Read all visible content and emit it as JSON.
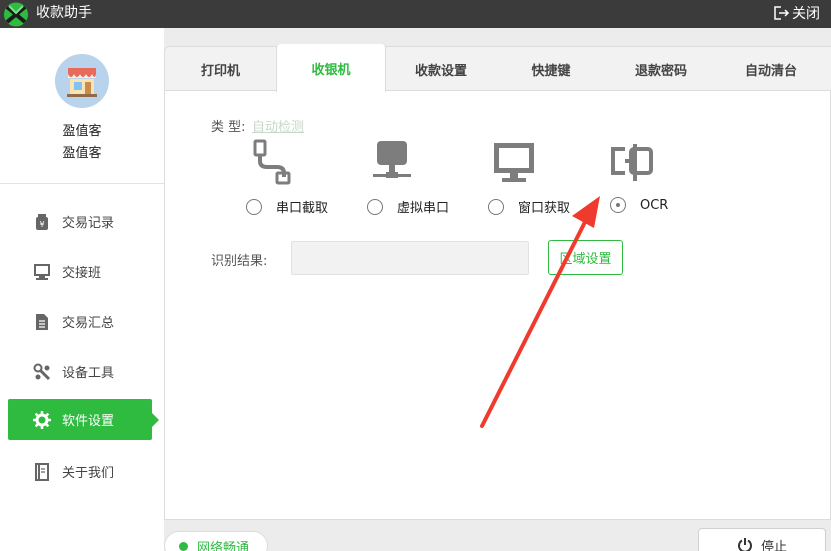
{
  "window": {
    "title": "收款助手",
    "close_label": "关闭"
  },
  "user": {
    "name_line1": "盈值客",
    "name_line2": "盈值客"
  },
  "sidebar": {
    "items": [
      {
        "label": "交易记录",
        "icon": "money-bag-icon",
        "active": false
      },
      {
        "label": "交接班",
        "icon": "monitor-icon",
        "active": false
      },
      {
        "label": "交易汇总",
        "icon": "document-icon",
        "active": false
      },
      {
        "label": "设备工具",
        "icon": "wrench-icon",
        "active": false
      },
      {
        "label": "软件设置",
        "icon": "gear-icon",
        "active": true
      },
      {
        "label": "关于我们",
        "icon": "book-icon",
        "active": false
      }
    ]
  },
  "tabs": [
    {
      "label": "打印机",
      "active": false
    },
    {
      "label": "收银机",
      "active": true
    },
    {
      "label": "收款设置",
      "active": false
    },
    {
      "label": "快捷键",
      "active": false
    },
    {
      "label": "退款密码",
      "active": false
    },
    {
      "label": "自动清台",
      "active": false
    }
  ],
  "cashier": {
    "type_label": "类 型:",
    "auto_detect_label": "自动检测",
    "options": [
      {
        "label": "串口截取",
        "icon": "serial-cable-icon",
        "selected": false
      },
      {
        "label": "虚拟串口",
        "icon": "network-icon",
        "selected": false
      },
      {
        "label": "窗口获取",
        "icon": "monitor-icon",
        "selected": false
      },
      {
        "label": "OCR",
        "icon": "ocr-scan-icon",
        "selected": true
      }
    ],
    "result_label": "识别结果:",
    "result_value": "",
    "region_button_label": "区域设置"
  },
  "status": {
    "network_label": "网络畅通",
    "stop_label": "停止"
  },
  "colors": {
    "accent": "#2fbb40",
    "titlebar": "#3b3b3b",
    "annotation_arrow": "#f03a2e"
  }
}
